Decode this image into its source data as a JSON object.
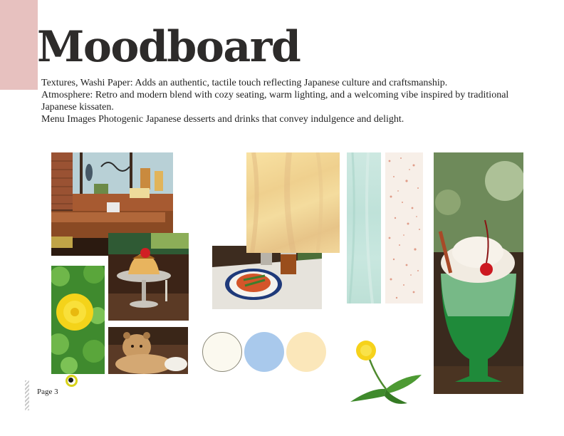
{
  "document": {
    "title": "Moodboard",
    "description": [
      "Textures, Washi Paper: Adds an authentic, tactile touch reflecting Japanese culture and craftsmanship.",
      "Atmosphere: Retro and modern blend with cozy seating, warm lighting, and a welcoming vibe inspired by traditional Japanese kissaten.",
      "Menu Images Photogenic Japanese desserts and drinks that convey indulgence and delight."
    ],
    "page_label": "Page 3"
  },
  "palette": {
    "pink_tab": "#e7c1bf",
    "swatches": [
      "#fbf9ef",
      "#a9c9ec",
      "#fbe7ba"
    ]
  },
  "images": [
    {
      "name": "cafe-interior-photo"
    },
    {
      "name": "pudding-dessert-photo"
    },
    {
      "name": "dandelion-clover-photo"
    },
    {
      "name": "lion-cub-photo"
    },
    {
      "name": "napolitan-spaghetti-photo"
    },
    {
      "name": "yellow-washi-texture"
    },
    {
      "name": "mint-washi-texture"
    },
    {
      "name": "speckled-washi-texture"
    },
    {
      "name": "dandelion-flower-illustration"
    },
    {
      "name": "melon-cream-soda-photo"
    }
  ]
}
